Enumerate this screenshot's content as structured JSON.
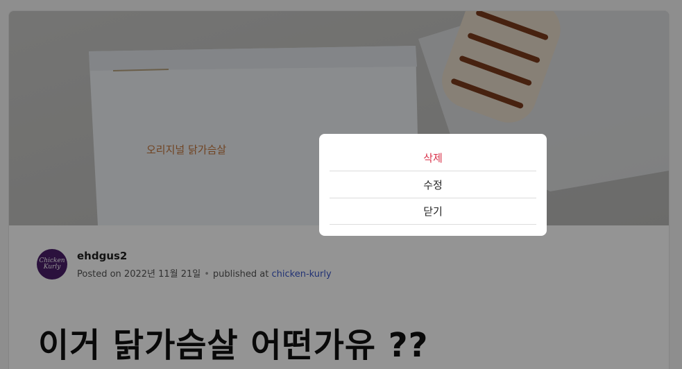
{
  "post": {
    "author": "ehdgus2",
    "avatar_text": "Chicken Kurly",
    "posted_prefix": "Posted on",
    "date": "2022년 11월 21일",
    "separator": "•",
    "published_prefix": "published at",
    "publication": "chicken-kurly",
    "title": "이거 닭가슴살 어떤가유 ??",
    "hero_package_text": "오리지널 닭가슴살"
  },
  "menu": {
    "delete_label": "삭제",
    "edit_label": "수정",
    "close_label": "닫기"
  },
  "colors": {
    "danger": "#d9324a",
    "link": "#3a57c9",
    "avatar_bg": "#4a1e6a",
    "overlay": "rgba(0,0,0,0.42)"
  }
}
